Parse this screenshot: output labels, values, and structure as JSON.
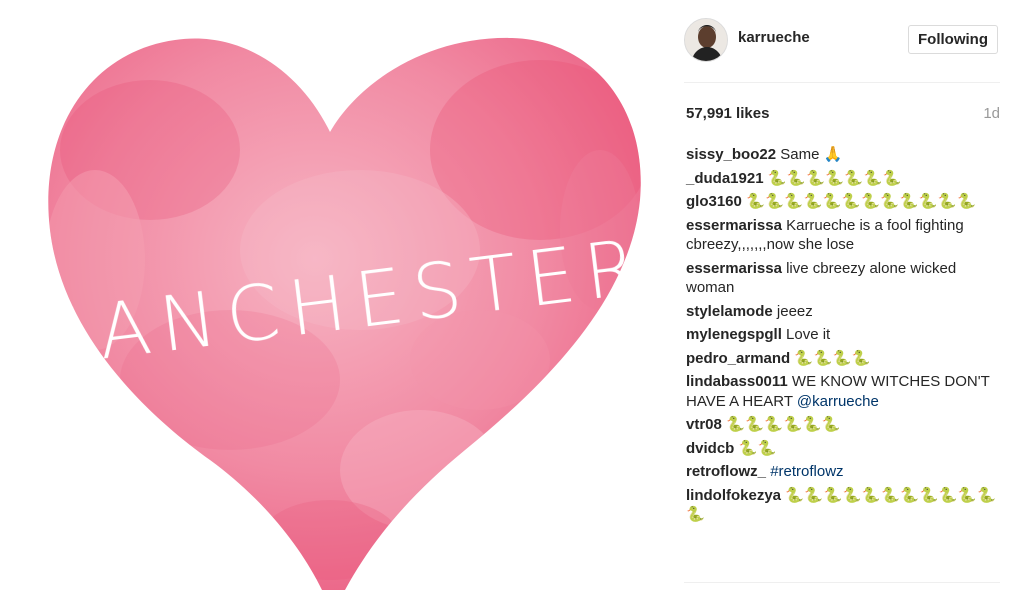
{
  "post": {
    "image_text": "MANCHESTER",
    "colors": {
      "heart_base": "#ef6f8e",
      "heart_light": "#f6a3b6",
      "heart_deep": "#e84a72",
      "text": "#ffffff"
    }
  },
  "header": {
    "username": "karrueche",
    "follow_label": "Following"
  },
  "stats": {
    "likes": "57,991 likes",
    "age": "1d"
  },
  "comments": [
    {
      "user": "sissy_boo22",
      "text": "Same",
      "emoji": "🙏"
    },
    {
      "user": "_duda1921",
      "emoji": "🐍🐍🐍🐍🐍🐍🐍"
    },
    {
      "user": "glo3160",
      "emoji": "🐍🐍🐍🐍🐍🐍🐍🐍🐍🐍🐍🐍"
    },
    {
      "user": "essermarissa",
      "text": "Karrueche is a fool fighting cbreezy,,,,,,,now she lose"
    },
    {
      "user": "essermarissa",
      "text": "live cbreezy alone wicked woman"
    },
    {
      "user": "stylelamode",
      "text": "jeeez"
    },
    {
      "user": "mylenegspgll",
      "text": "Love it"
    },
    {
      "user": "pedro_armand",
      "emoji": "🐍🐍🐍🐍"
    },
    {
      "user": "lindabass0011",
      "text": "WE KNOW WITCHES DON'T HAVE A HEART",
      "mention": "@karrueche"
    },
    {
      "user": "vtr08",
      "emoji": "🐍🐍🐍🐍🐍🐍"
    },
    {
      "user": "dvidcb",
      "emoji": "🐍🐍"
    },
    {
      "user": "retroflowz_",
      "hashtag": "#retroflowz"
    },
    {
      "user": "lindolfokezya",
      "emoji": "🐍🐍🐍🐍🐍🐍🐍🐍🐍🐍🐍🐍"
    }
  ]
}
